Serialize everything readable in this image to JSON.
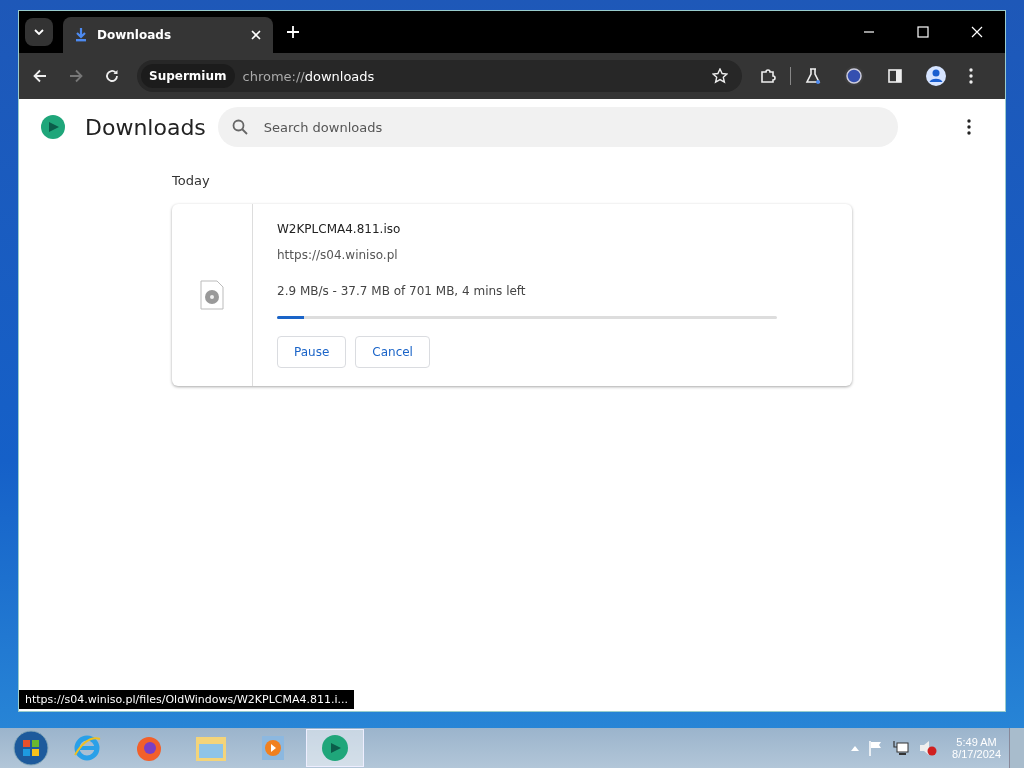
{
  "tabs": [
    {
      "title": "Downloads",
      "selected": true
    }
  ],
  "toolbar": {
    "site_chip": "Supermium",
    "url_scheme": "chrome://",
    "url_host": "downloads"
  },
  "page": {
    "title": "Downloads",
    "search": {
      "placeholder": "Search downloads"
    },
    "section": "Today",
    "download": {
      "name": "W2KPLCMA4.811.iso",
      "url": "https://s04.winiso.pl",
      "status": "2.9 MB/s - 37.7 MB of 701 MB, 4 mins left",
      "level": 0.054,
      "buttons": [
        "Pause",
        "Cancel"
      ]
    }
  },
  "status_bar": {
    "link": "https://s04.winiso.pl/files/OldWindows/W2KPLCMA4.811.i..."
  },
  "taskbar": {
    "apps": [
      {
        "kind": "ie",
        "selected": false
      },
      {
        "kind": "firefox",
        "selected": false
      },
      {
        "kind": "explorer",
        "selected": false
      },
      {
        "kind": "media",
        "selected": false
      },
      {
        "kind": "browser",
        "selected": true
      }
    ],
    "volume_muted": true,
    "time": "5:49 AM",
    "date": "8/17/2024"
  }
}
